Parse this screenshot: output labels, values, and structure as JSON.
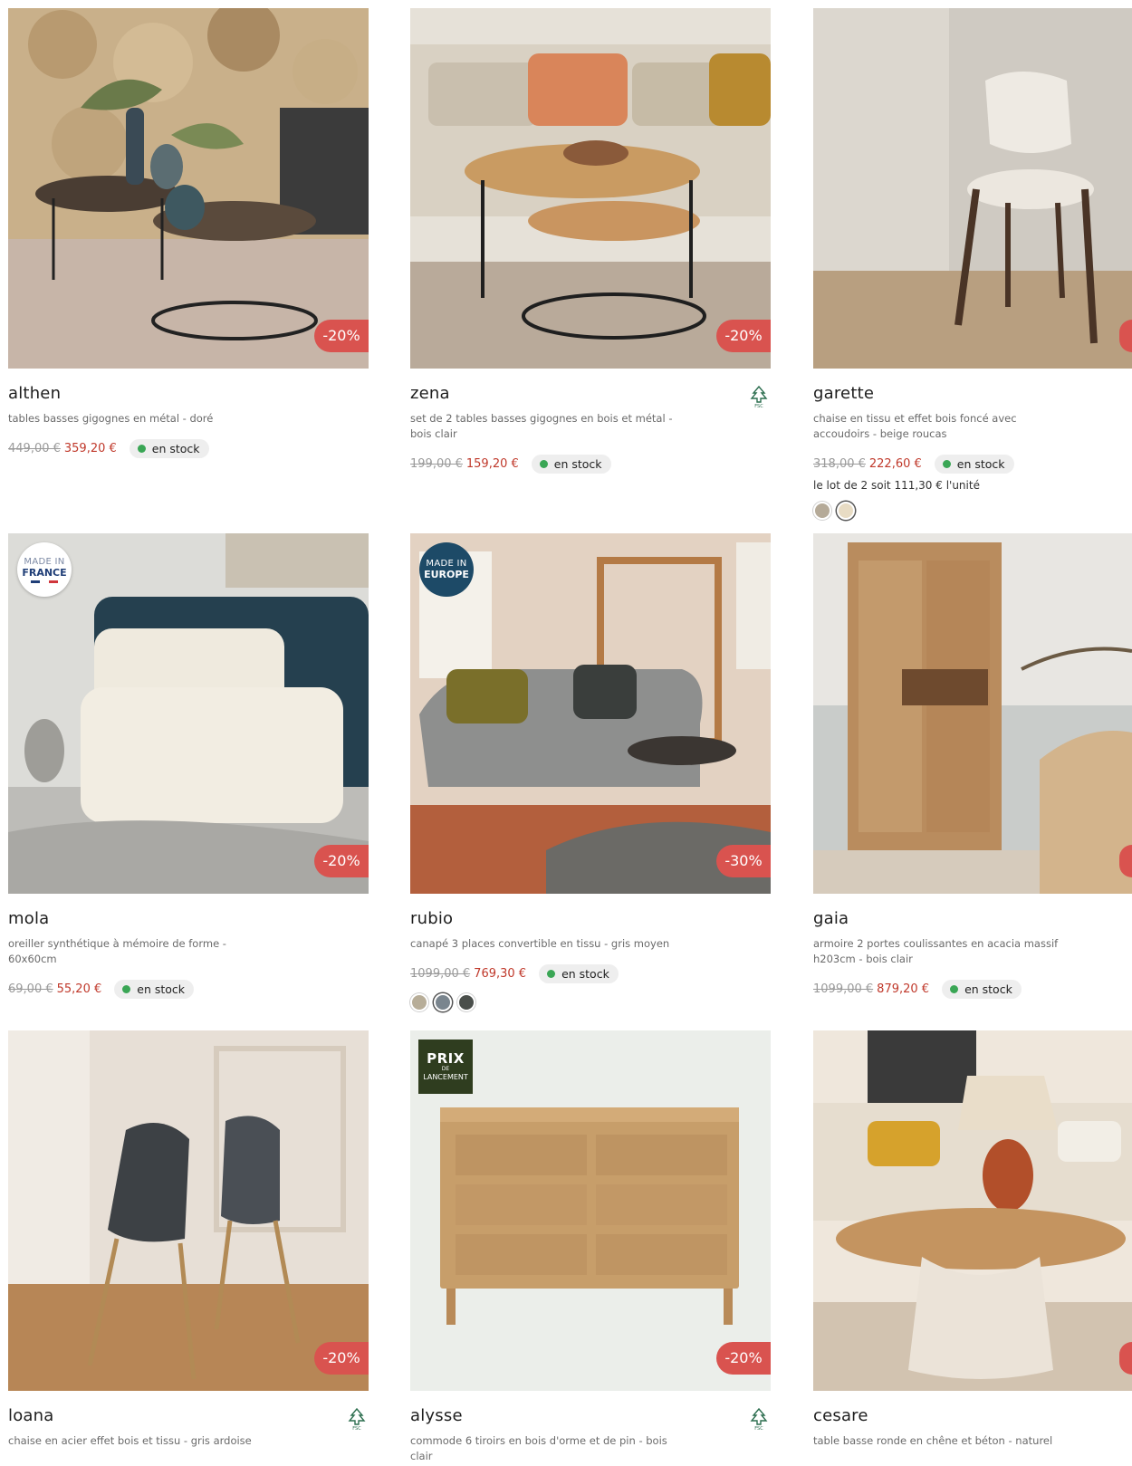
{
  "products": [
    {
      "name": "althen",
      "description": "tables basses gigognes en métal - doré",
      "old_price": "449,00 €",
      "new_price": "359,20 €",
      "stock": "en stock",
      "discount": "-20%"
    },
    {
      "name": "zena",
      "description": "set de 2 tables basses gigognes en bois et métal - bois clair",
      "old_price": "199,00 €",
      "new_price": "159,20 €",
      "stock": "en stock",
      "discount": "-20%",
      "fsc_icon": "fsc-tree-icon"
    },
    {
      "name": "garette",
      "description": "chaise en tissu et effet bois foncé avec accoudoirs - beige roucas",
      "old_price": "318,00 €",
      "new_price": "222,60 €",
      "stock": "en stock",
      "unit_price": "le lot de 2 soit 111,30 € l'unité",
      "swatches": [
        "#b5aa98",
        "#e8dcc4"
      ]
    },
    {
      "name": "mola",
      "description": "oreiller synthétique à mémoire de forme - 60x60cm",
      "old_price": "69,00 €",
      "new_price": "55,20 €",
      "stock": "en stock",
      "discount": "-20%",
      "badge": {
        "line1": "MADE IN",
        "line2": "FRANCE"
      }
    },
    {
      "name": "rubio",
      "description": "canapé 3 places convertible en tissu - gris moyen",
      "old_price": "1099,00 €",
      "new_price": "769,30 €",
      "stock": "en stock",
      "discount": "-30%",
      "badge": {
        "line1": "MADE IN",
        "line2": "EUROPE"
      },
      "swatches": [
        "#b7ad98",
        "#7a858e",
        "#4a4f4b"
      ]
    },
    {
      "name": "gaia",
      "description": "armoire 2 portes coulissantes en acacia massif h203cm - bois clair",
      "old_price": "1099,00 €",
      "new_price": "879,20 €",
      "stock": "en stock"
    },
    {
      "name": "loana",
      "description": "chaise en acier effet bois et tissu - gris ardoise",
      "discount": "-20%",
      "fsc_icon": "fsc-tree-icon"
    },
    {
      "name": "alysse",
      "description": "commode 6 tiroirs en bois d'orme et de pin - bois clair",
      "discount": "-20%",
      "fsc_icon": "fsc-tree-icon",
      "badge": {
        "line1": "PRIX",
        "line2": "DE",
        "line3": "LANCEMENT"
      }
    },
    {
      "name": "cesare",
      "description": "table basse ronde en chêne et béton - naturel"
    }
  ],
  "colors": {
    "discount": "#d9534f",
    "sale_price": "#c0392b",
    "in_stock": "#3aa655",
    "fsc": "#2c6e4f"
  }
}
